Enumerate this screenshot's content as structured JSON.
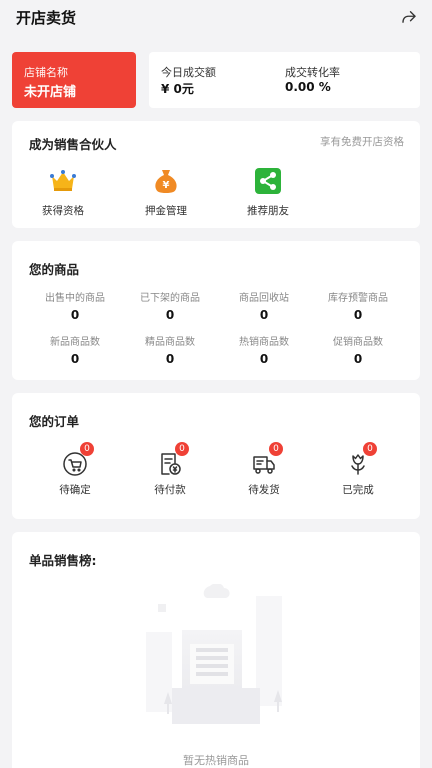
{
  "header": {
    "title": "开店卖货",
    "share_icon": "share-icon"
  },
  "shop": {
    "name_label": "店铺名称",
    "name_value": "未开店铺",
    "accent": "#ef4136"
  },
  "stats": {
    "today_label": "今日成交额",
    "today_value": "¥ 0元",
    "rate_label": "成交转化率",
    "rate_value": "0.00 %"
  },
  "partner": {
    "title": "成为销售合伙人",
    "right": "享有免费开店资格",
    "items": [
      {
        "label": "获得资格",
        "icon": "crown-icon"
      },
      {
        "label": "押金管理",
        "icon": "money-bag-icon"
      },
      {
        "label": "推荐朋友",
        "icon": "share-friends-icon"
      }
    ]
  },
  "goods": {
    "title": "您的商品",
    "cells": [
      {
        "label": "出售中的商品",
        "value": "0"
      },
      {
        "label": "已下架的商品",
        "value": "0"
      },
      {
        "label": "商品回收站",
        "value": "0"
      },
      {
        "label": "库存预警商品",
        "value": "0"
      },
      {
        "label": "新品商品数",
        "value": "0"
      },
      {
        "label": "精品商品数",
        "value": "0"
      },
      {
        "label": "热销商品数",
        "value": "0"
      },
      {
        "label": "促销商品数",
        "value": "0"
      }
    ]
  },
  "orders": {
    "title": "您的订单",
    "items": [
      {
        "label": "待确定",
        "badge": "0",
        "icon": "cart-icon"
      },
      {
        "label": "待付款",
        "badge": "0",
        "icon": "bill-icon"
      },
      {
        "label": "待发货",
        "badge": "0",
        "icon": "truck-icon"
      },
      {
        "label": "已完成",
        "badge": "0",
        "icon": "flower-icon"
      }
    ]
  },
  "ranking": {
    "title": "单品销售榜:",
    "empty_text": "暂无热销商品",
    "empty_icon": "empty-document-illustration"
  }
}
